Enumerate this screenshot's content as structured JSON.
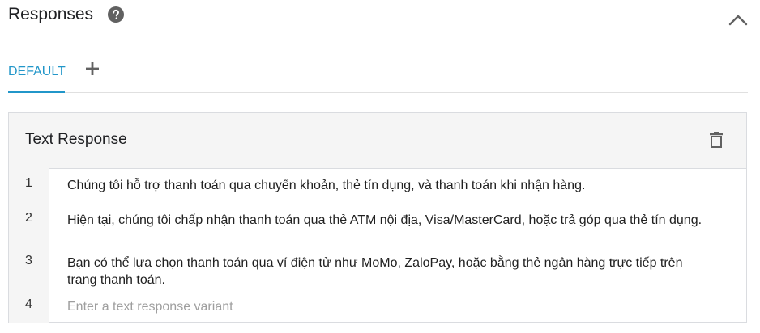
{
  "section": {
    "title": "Responses",
    "help_icon": "help-circle-icon",
    "collapse_icon": "chevron-up-icon"
  },
  "tabs": {
    "items": [
      {
        "label": "DEFAULT",
        "active": true
      }
    ],
    "add_icon": "plus-icon"
  },
  "card": {
    "title": "Text Response",
    "delete_icon": "trash-icon",
    "rows": [
      {
        "num": "1",
        "text": "Chúng tôi hỗ trợ thanh toán qua chuyển khoản, thẻ tín dụng, và thanh toán khi nhận hàng."
      },
      {
        "num": "2",
        "text": "Hiện tại, chúng tôi chấp nhận thanh toán qua thẻ ATM nội địa, Visa/MasterCard, hoặc trả góp qua thẻ tín dụng."
      },
      {
        "num": "3",
        "text": "Bạn có thể lựa chọn thanh toán qua ví điện tử như MoMo, ZaloPay, hoặc bằng thẻ ngân hàng trực tiếp trên trang thanh toán."
      },
      {
        "num": "4",
        "text": "",
        "placeholder": "Enter a text response variant"
      }
    ]
  },
  "colors": {
    "accent": "#2196c9",
    "header_bg": "#f5f5f5",
    "border": "#dadce0"
  }
}
